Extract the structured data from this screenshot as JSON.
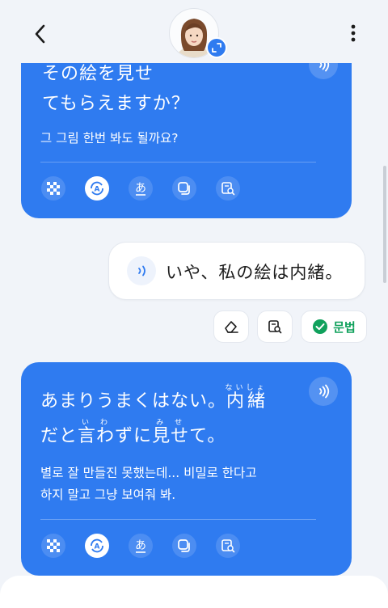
{
  "header": {
    "back_icon": "chevron-left-icon",
    "more_icon": "more-vertical-icon",
    "avatar_icon": "avatar-portrait",
    "expand_icon": "expand-arrows-icon"
  },
  "messages": {
    "ai1": {
      "jp_line1": "その絵を見せ",
      "jp_line2": "てもらえますか？",
      "ko": "그 그림 한번 봐도 될까요?"
    },
    "user": {
      "text": "いや、私の絵は内緒。"
    },
    "user_actions": {
      "grammar_label": "문법"
    },
    "ai2": {
      "jp_line1_a": "あまりうまくはない。",
      "jp_line1_b_base": "内緒",
      "jp_line1_b_ruby": "ないしょ",
      "jp_line2_a": "だと",
      "jp_line2_b_base": "言",
      "jp_line2_b_ruby": "い",
      "jp_line2_c": "わ",
      "jp_line2_c_ruby": "わ",
      "jp_line2_d": "ずに",
      "jp_line2_e_base": "見せ",
      "jp_line2_e_ruby": "みせ",
      "jp_line2_f": "て。",
      "ko_line1": "별로 잘 만들진 못했는데... 비밀로 한다고",
      "ko_line2": "하지 말고 그냥 보여줘 봐."
    }
  },
  "colors": {
    "accent": "#2f7bf0",
    "grammar_green": "#10a15c",
    "background": "#f1f4f9"
  }
}
